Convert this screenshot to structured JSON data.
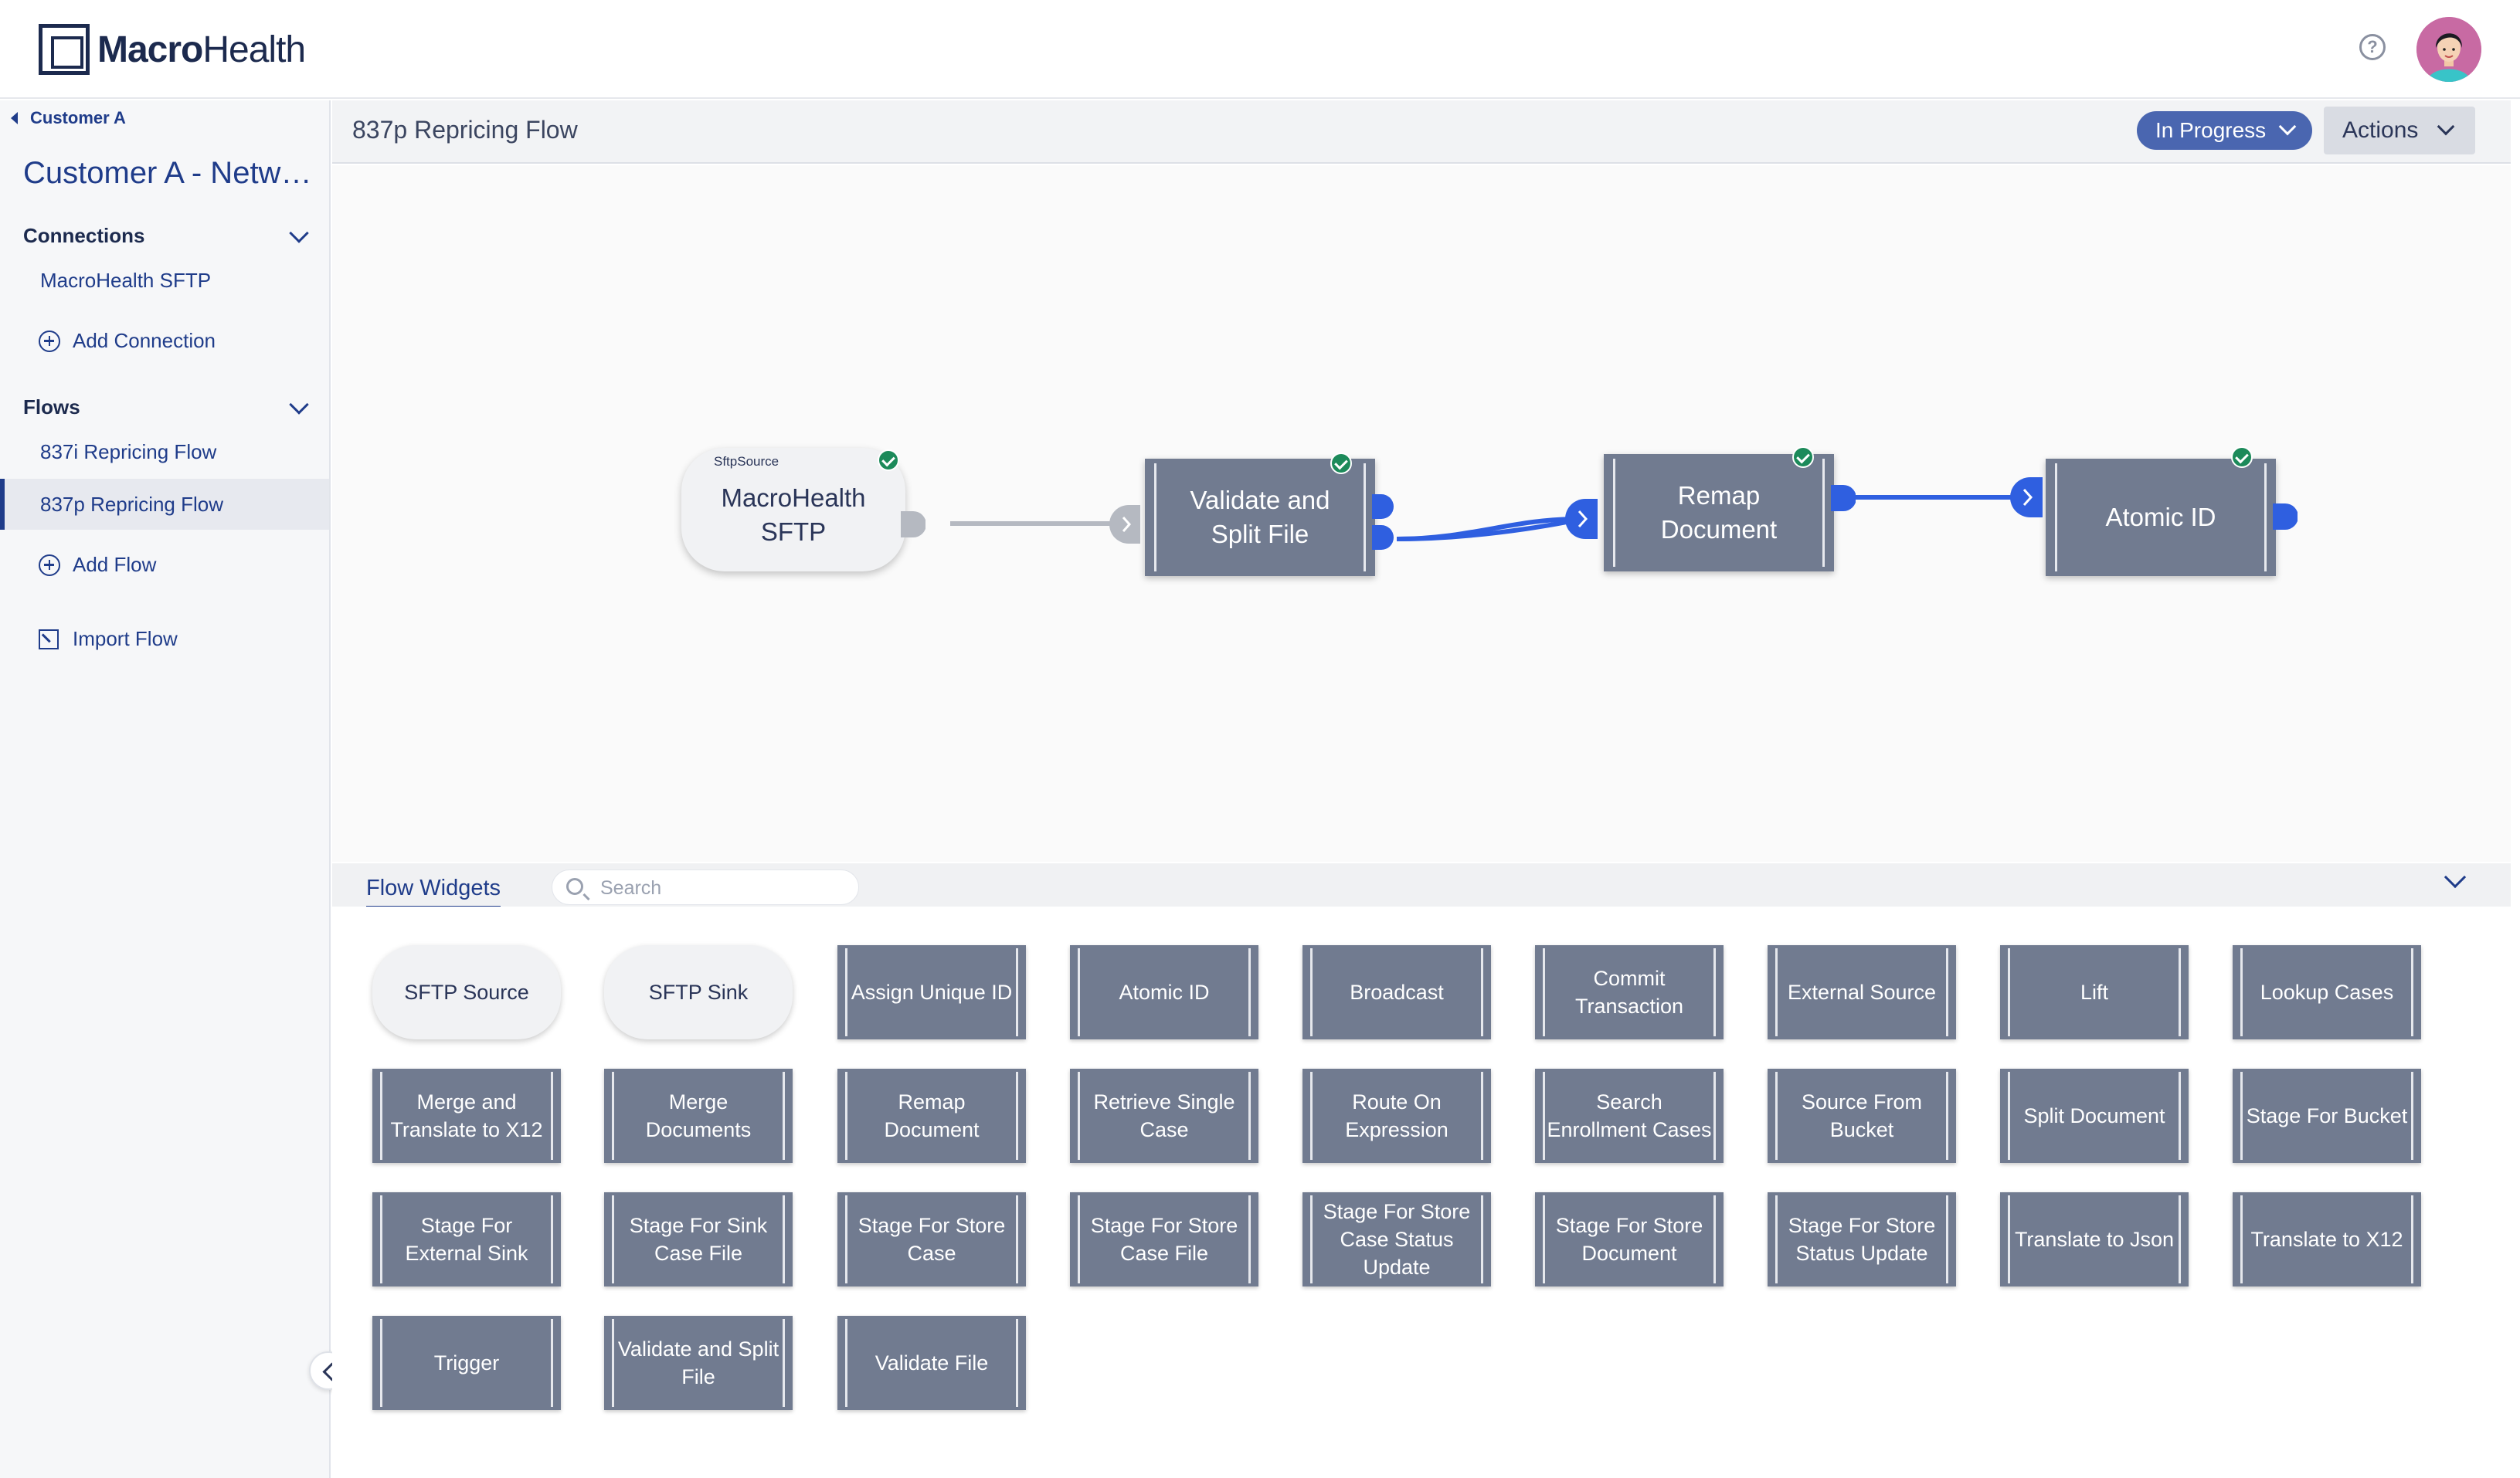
{
  "app": {
    "brand_bold": "Macro",
    "brand_light": "Health"
  },
  "header": {
    "help_icon": "help-circle-icon",
    "avatar": "user-avatar"
  },
  "sidebar": {
    "back_label": "Customer A",
    "network_title": "Customer A - Netwo…",
    "connections_label": "Connections",
    "connections": [
      "MacroHealth SFTP"
    ],
    "add_connection_label": "Add Connection",
    "flows_label": "Flows",
    "flows": [
      "837i Repricing Flow",
      "837p Repricing Flow"
    ],
    "active_flow_index": 1,
    "add_flow_label": "Add Flow",
    "import_flow_label": "Import Flow"
  },
  "flow": {
    "title": "837p Repricing Flow",
    "status": "In Progress",
    "actions_label": "Actions"
  },
  "canvas": {
    "nodes": [
      {
        "type_label": "SftpSource",
        "label_line1": "MacroHealth",
        "label_line2": "SFTP",
        "valid": true
      },
      {
        "label_line1": "Validate and",
        "label_line2": "Split File",
        "valid": true
      },
      {
        "label_line1": "Remap",
        "label_line2": "Document",
        "valid": true
      },
      {
        "label_line1": "Atomic ID",
        "valid": true
      }
    ]
  },
  "widgets": {
    "tab_label": "Flow Widgets",
    "search_placeholder": "Search",
    "items": [
      "SFTP Source",
      "SFTP Sink",
      "Assign Unique ID",
      "Atomic ID",
      "Broadcast",
      "Commit Transaction",
      "External Source",
      "Lift",
      "Lookup Cases",
      "Merge and Translate to X12",
      "Merge Documents",
      "Remap Document",
      "Retrieve Single Case",
      "Route On Expression",
      "Search Enrollment Cases",
      "Source From Bucket",
      "Split Document",
      "Stage For Bucket",
      "Stage For External Sink",
      "Stage For Sink Case File",
      "Stage For Store Case",
      "Stage For Store Case File",
      "Stage For Store Case Status Update",
      "Stage For Store Document",
      "Stage For Store Status Update",
      "Translate to Json",
      "Translate to X12",
      "Trigger",
      "Validate and Split File",
      "Validate File"
    ]
  },
  "colors": {
    "primary": "#1f3c8a",
    "status_pill": "#4a66b0",
    "node_fill": "#717b90",
    "wire_active": "#2f5fe0",
    "wire_inactive": "#b5b9c1",
    "valid_check": "#1c8a5a"
  }
}
